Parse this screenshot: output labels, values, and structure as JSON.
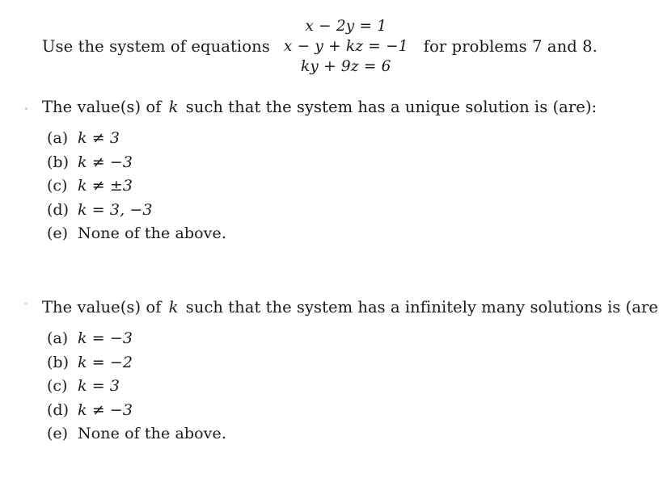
{
  "document": {
    "background_color": "#ffffff",
    "text_color": "#1a1a1a"
  },
  "intro": {
    "lead_text": "Use the system of equations",
    "tail_text": "for problems 7 and 8.",
    "system": {
      "equations": [
        "x − 2y = 1",
        "x − y + kz = −1",
        "ky + 9z = 6"
      ],
      "equation_1": "x − 2y = 1",
      "equation_2": "x − y + kz = −1",
      "equation_3": "ky + 9z = 6"
    }
  },
  "questions": [
    {
      "id": "question-7",
      "stem_before_var": "The value(s)  of",
      "variable": "k",
      "stem_after_var": "such that the system has a unique solution is (are):",
      "options": [
        {
          "label": "(a)",
          "text": "k ≠ 3"
        },
        {
          "label": "(b)",
          "text": "k ≠ −3"
        },
        {
          "label": "(c)",
          "text": "k ≠ ±3"
        },
        {
          "label": "(d)",
          "text": "k = 3,  −3"
        },
        {
          "label": "(e)",
          "text": "None of the above."
        }
      ]
    },
    {
      "id": "question-8",
      "stem_before_var": "The value(s)  of",
      "variable": "k",
      "stem_after_var": "such that the system has a infinitely many solutions is (are):",
      "options": [
        {
          "label": "(a)",
          "text": "k = −3"
        },
        {
          "label": "(b)",
          "text": "k = −2"
        },
        {
          "label": "(c)",
          "text": "k = 3"
        },
        {
          "label": "(d)",
          "text": "k ≠ −3"
        },
        {
          "label": "(e)",
          "text": "None of the above."
        }
      ]
    }
  ]
}
